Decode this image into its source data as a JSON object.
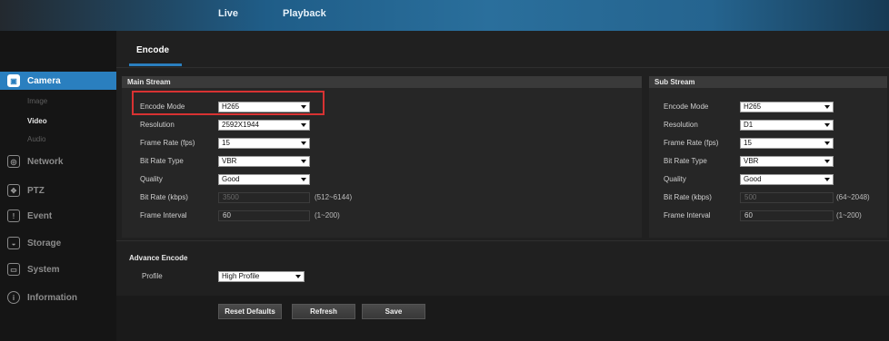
{
  "topnav": {
    "live": "Live",
    "playback": "Playback"
  },
  "sidebar": {
    "camera": "Camera",
    "camera_sub": [
      "Image",
      "Video",
      "Audio"
    ],
    "network": "Network",
    "ptz": "PTZ",
    "event": "Event",
    "storage": "Storage",
    "system": "System",
    "information": "Information"
  },
  "tab": {
    "encode": "Encode"
  },
  "main_stream": {
    "title": "Main Stream",
    "encode_mode_label": "Encode Mode",
    "encode_mode": "H265",
    "resolution_label": "Resolution",
    "resolution": "2592X1944",
    "frame_rate_label": "Frame Rate (fps)",
    "frame_rate": "15",
    "bit_rate_type_label": "Bit Rate Type",
    "bit_rate_type": "VBR",
    "quality_label": "Quality",
    "quality": "Good",
    "bit_rate_label": "Bit Rate (kbps)",
    "bit_rate": "3500",
    "bit_rate_range": "(512~6144)",
    "frame_interval_label": "Frame Interval",
    "frame_interval": "60",
    "frame_interval_range": "(1~200)"
  },
  "sub_stream": {
    "title": "Sub Stream",
    "encode_mode_label": "Encode Mode",
    "encode_mode": "H265",
    "resolution_label": "Resolution",
    "resolution": "D1",
    "frame_rate_label": "Frame Rate (fps)",
    "frame_rate": "15",
    "bit_rate_type_label": "Bit Rate Type",
    "bit_rate_type": "VBR",
    "quality_label": "Quality",
    "quality": "Good",
    "bit_rate_label": "Bit Rate (kbps)",
    "bit_rate": "500",
    "bit_rate_range": "(64~2048)",
    "frame_interval_label": "Frame Interval",
    "frame_interval": "60",
    "frame_interval_range": "(1~200)"
  },
  "advance": {
    "title": "Advance Encode",
    "profile_label": "Profile",
    "profile": "High Profile"
  },
  "buttons": {
    "reset": "Reset Defaults",
    "refresh": "Refresh",
    "save": "Save"
  },
  "colors": {
    "accent": "#2a7fbf",
    "highlight": "#d83232"
  }
}
